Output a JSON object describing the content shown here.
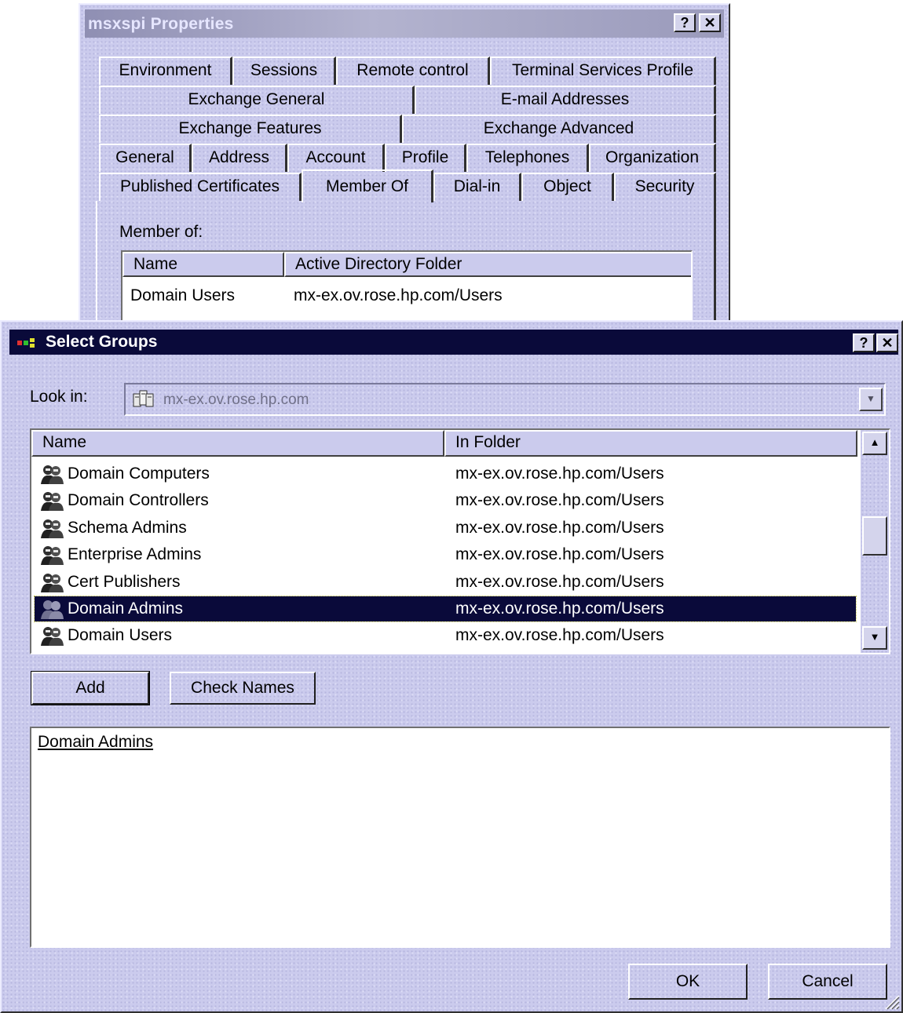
{
  "properties_window": {
    "title": "msxspi Properties",
    "help_button": "?",
    "close_button": "✕",
    "tabs_row1": [
      "Environment",
      "Sessions",
      "Remote control",
      "Terminal Services Profile"
    ],
    "tabs_row2": [
      "Exchange General",
      "E-mail Addresses"
    ],
    "tabs_row3": [
      "Exchange Features",
      "Exchange Advanced"
    ],
    "tabs_row4": [
      "General",
      "Address",
      "Account",
      "Profile",
      "Telephones",
      "Organization"
    ],
    "tabs_row5": [
      "Published Certificates",
      "Member Of",
      "Dial-in",
      "Object",
      "Security"
    ],
    "active_tab": "Member Of",
    "member_of_label": "Member of:",
    "columns": [
      "Name",
      "Active Directory Folder"
    ],
    "rows": [
      {
        "name": "Domain Users",
        "folder": "mx-ex.ov.rose.hp.com/Users"
      }
    ]
  },
  "select_groups": {
    "title": "Select Groups",
    "help_button": "?",
    "close_button": "✕",
    "look_in_label": "Look in:",
    "look_in_value": "mx-ex.ov.rose.hp.com",
    "columns": [
      "Name",
      "In Folder"
    ],
    "groups": [
      {
        "name": "Domain Computers",
        "folder": "mx-ex.ov.rose.hp.com/Users"
      },
      {
        "name": "Domain Controllers",
        "folder": "mx-ex.ov.rose.hp.com/Users"
      },
      {
        "name": "Schema Admins",
        "folder": "mx-ex.ov.rose.hp.com/Users"
      },
      {
        "name": "Enterprise Admins",
        "folder": "mx-ex.ov.rose.hp.com/Users"
      },
      {
        "name": "Cert Publishers",
        "folder": "mx-ex.ov.rose.hp.com/Users"
      },
      {
        "name": "Domain Admins",
        "folder": "mx-ex.ov.rose.hp.com/Users"
      },
      {
        "name": "Domain Users",
        "folder": "mx-ex.ov.rose.hp.com/Users"
      }
    ],
    "selected_group": "Domain Admins",
    "add_button": "Add",
    "check_names_button": "Check Names",
    "selected_names": "Domain Admins",
    "ok_button": "OK",
    "cancel_button": "Cancel"
  },
  "colors": {
    "face": "#cbcbed",
    "selection": "#0a0a3a",
    "active_title": "#0a0a3a",
    "inactive_title": "#a3a3c3"
  }
}
